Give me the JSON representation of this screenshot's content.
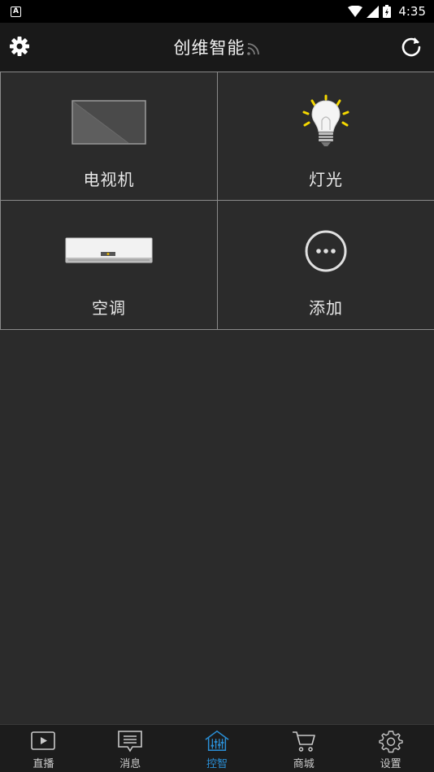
{
  "status_bar": {
    "time": "4:35",
    "app_icon_letter": "A"
  },
  "header": {
    "title": "创维智能"
  },
  "devices": [
    {
      "label": "电视机",
      "icon": "tv-icon"
    },
    {
      "label": "灯光",
      "icon": "light-bulb-icon"
    },
    {
      "label": "空调",
      "icon": "air-conditioner-icon"
    },
    {
      "label": "添加",
      "icon": "more-icon"
    }
  ],
  "bottom_nav": [
    {
      "label": "直播",
      "icon": "play-icon"
    },
    {
      "label": "消息",
      "icon": "message-icon"
    },
    {
      "label": "控智",
      "icon": "home-control-icon",
      "active": true
    },
    {
      "label": "商城",
      "icon": "cart-icon"
    },
    {
      "label": "设置",
      "icon": "gear-icon"
    }
  ],
  "colors": {
    "active": "#2a8fd6",
    "background": "#2b2b2b",
    "header": "#191919",
    "bulb_rays": "#f5d800"
  }
}
